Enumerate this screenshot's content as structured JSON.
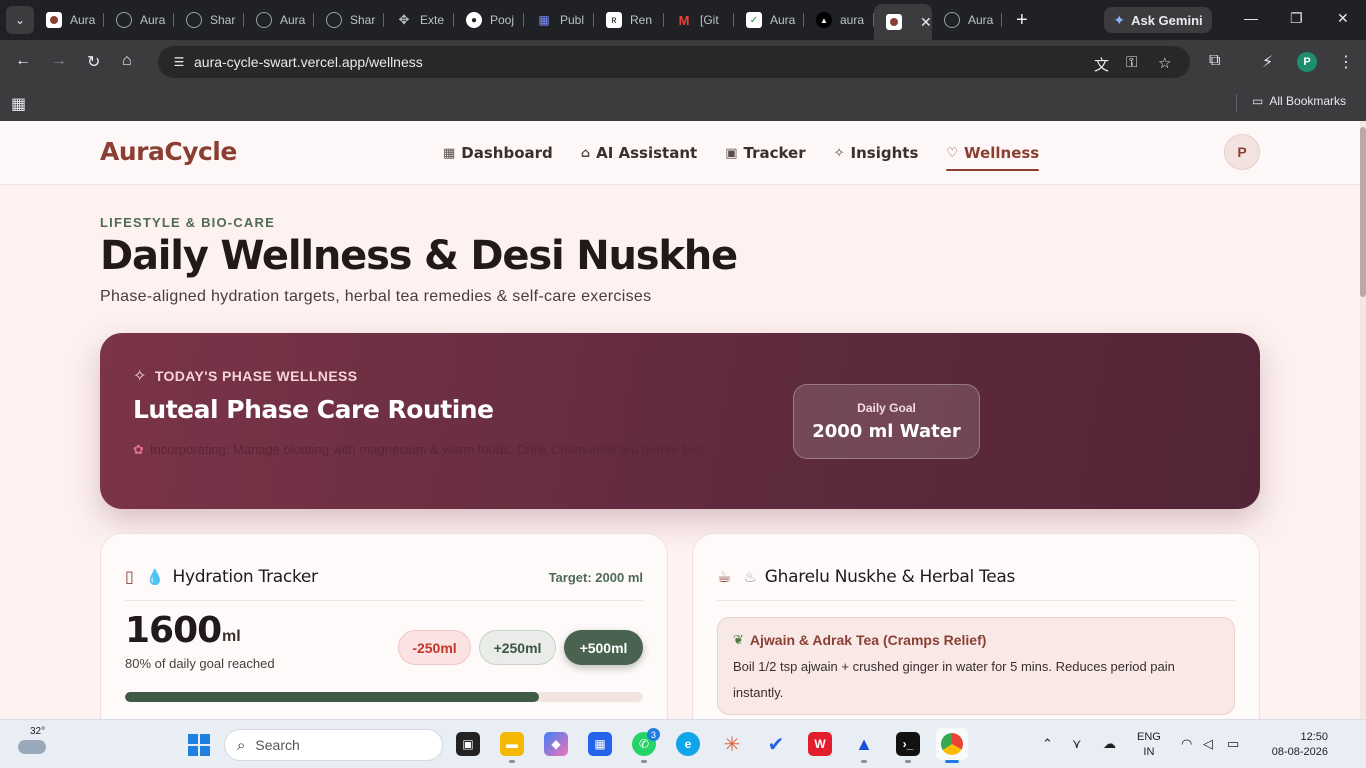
{
  "browser": {
    "tabs": [
      {
        "label": "Aura",
        "icon": "aura-favicon"
      },
      {
        "label": "Aura",
        "icon": "globe-icon"
      },
      {
        "label": "Shar",
        "icon": "share-favicon"
      },
      {
        "label": "Aura",
        "icon": "globe-icon"
      },
      {
        "label": "Shar",
        "icon": "share-favicon"
      },
      {
        "label": "Exte",
        "icon": "puzzle-icon"
      },
      {
        "label": "Pooj",
        "icon": "github-icon"
      },
      {
        "label": "Publ",
        "icon": "grid-favicon"
      },
      {
        "label": "Ren",
        "icon": "render-favicon"
      },
      {
        "label": "[Git",
        "icon": "gmail-icon"
      },
      {
        "label": "Aura",
        "icon": "check-favicon"
      },
      {
        "label": "aura",
        "icon": "vercel-icon"
      }
    ],
    "ask_gemini": "Ask Gemini",
    "url": "aura-cycle-swart.vercel.app/wellness",
    "profile_initial": "P",
    "all_bookmarks": "All Bookmarks"
  },
  "app": {
    "brand": "AuraCycle",
    "nav": [
      {
        "label": "Dashboard",
        "icon": "dashboard-icon"
      },
      {
        "label": "AI Assistant",
        "icon": "robot-icon"
      },
      {
        "label": "Tracker",
        "icon": "calendar-icon"
      },
      {
        "label": "Insights",
        "icon": "sparkle-icon"
      },
      {
        "label": "Wellness",
        "icon": "heart-pulse-icon",
        "active": true
      }
    ],
    "avatar_initial": "P"
  },
  "page": {
    "eyebrow": "LIFESTYLE & BIO-CARE",
    "title": "Daily Wellness & Desi Nuskhe",
    "subtitle": "Phase-aligned hydration targets, herbal tea remedies & self-care exercises"
  },
  "hero": {
    "eyebrow": "TODAY'S PHASE WELLNESS",
    "title": "Luteal Phase Care Routine",
    "description": "Incorporating: Manage bloating with magnesium & warm foods. Drink Chamomile tea before bed.",
    "goal_label": "Daily Goal",
    "goal_value": "2000 ml Water"
  },
  "hydration": {
    "title": "Hydration Tracker",
    "target": "Target: 2000 ml",
    "current": "1600",
    "unit": "ml",
    "note": "80% of daily goal reached",
    "progress_fraction": 0.8,
    "buttons": {
      "minus": "-250ml",
      "plus250": "+250ml",
      "plus500": "+500ml"
    }
  },
  "teas": {
    "title": "Gharelu Nuskhe & Herbal Teas",
    "remedy_title": "Ajwain & Adrak Tea (Cramps Relief)",
    "remedy_body": "Boil 1/2 tsp ajwain + crushed ginger in water for 5 mins. Reduces period pain instantly."
  },
  "taskbar": {
    "temperature": "32°",
    "search_placeholder": "Search",
    "whatsapp_badge": "3",
    "lang_top": "ENG",
    "lang_bottom": "IN",
    "time": "12:50",
    "date": "08-08-2026"
  },
  "colors": {
    "brand": "#8b3f33",
    "hero_start": "#7b3448",
    "hero_end": "#532536",
    "accent_green": "#4e6b57",
    "progress": "#3f5a47"
  }
}
